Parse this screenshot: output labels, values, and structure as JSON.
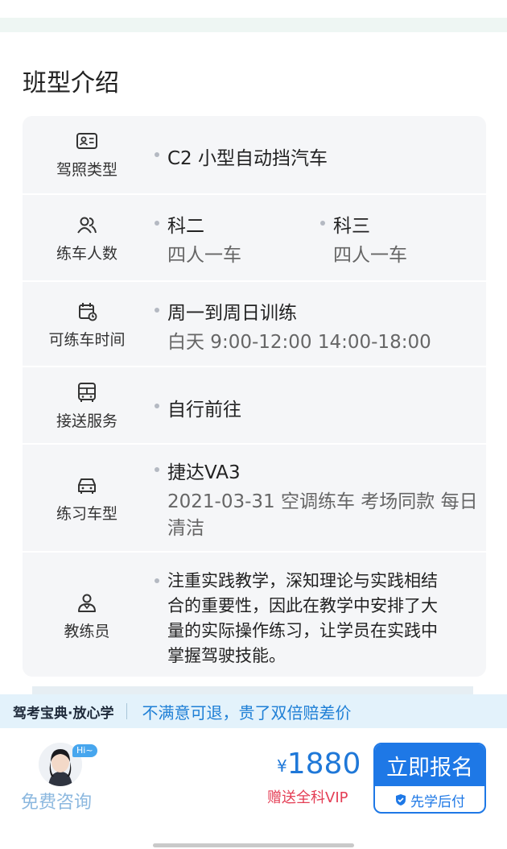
{
  "section_title": "班型介绍",
  "rows": [
    {
      "label": "驾照类型",
      "icon": "license-card-icon",
      "items": [
        {
          "main": "C2 小型自动挡汽车"
        }
      ]
    },
    {
      "label": "练车人数",
      "icon": "people-icon",
      "items": [
        {
          "main": "科二",
          "sub": "四人一车"
        },
        {
          "main": "科三",
          "sub": "四人一车"
        }
      ]
    },
    {
      "label": "可练车时间",
      "icon": "calendar-clock-icon",
      "items": [
        {
          "main": "周一到周日训练",
          "sub": "白天 9:00-12:00 14:00-18:00"
        }
      ]
    },
    {
      "label": "接送服务",
      "icon": "bus-icon",
      "items": [
        {
          "main": "自行前往"
        }
      ]
    },
    {
      "label": "练习车型",
      "icon": "car-icon",
      "items": [
        {
          "main": "捷达VA3",
          "sub_line1": "2021-03-31 空调练车 考场同款 每日",
          "sub_line2": "清洁"
        }
      ]
    },
    {
      "label": "教练员",
      "icon": "coach-icon",
      "items": [
        {
          "lines": [
            "注重实践教学，深知理论与实践相结",
            "合的重要性，因此在教学中安排了大",
            "量的实际操作练习，让学员在实践中",
            "掌握驾驶技能。"
          ]
        }
      ]
    }
  ],
  "banner": {
    "brand": "驾考宝典·放心学",
    "slogan": "不满意可退，贵了双倍赔差价"
  },
  "bottom": {
    "hi_badge": "Hi~",
    "consult": "免费咨询",
    "currency": "¥",
    "price": "1880",
    "vip": "赠送全科VIP",
    "enroll": "立即报名",
    "pay_later": "先学后付"
  },
  "colors": {
    "accent": "#1e78e6",
    "price": "#1f78d8",
    "vip": "#e43e55",
    "card_bg": "#f5f6f8"
  }
}
